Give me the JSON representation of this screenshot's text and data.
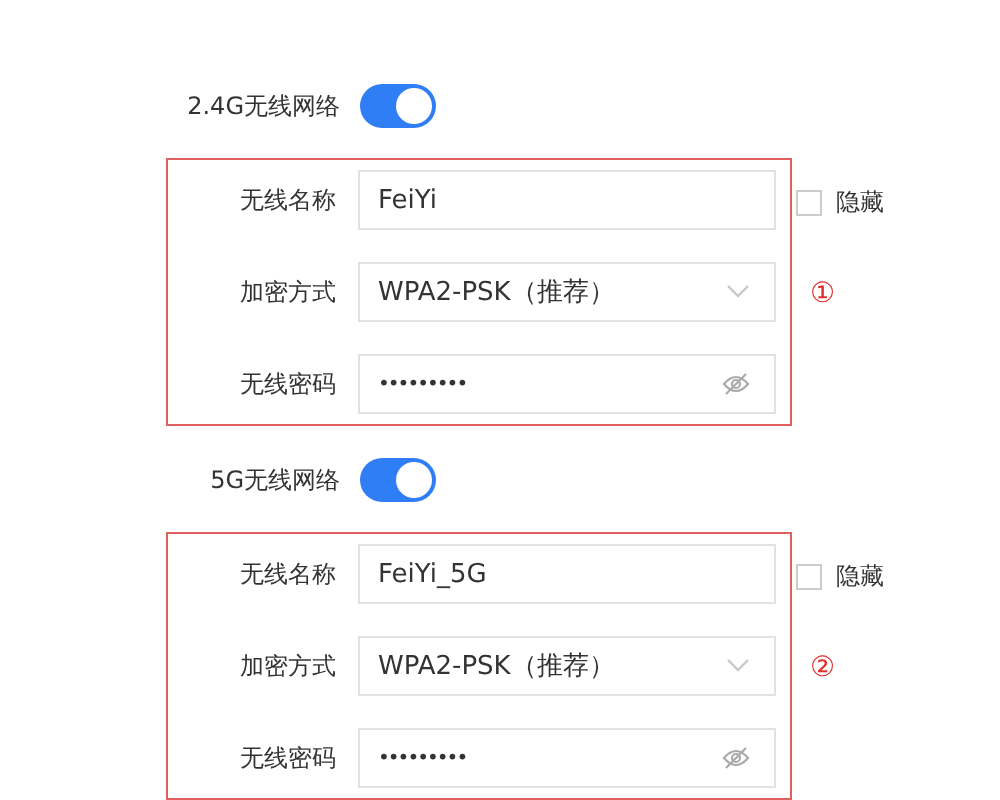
{
  "sections": [
    {
      "label": "2.4G无线网络",
      "enabled": true,
      "marker": "①",
      "fields": [
        {
          "kind": "text",
          "label": "无线名称",
          "value": "FeiYi",
          "hide": {
            "label": "隐藏",
            "checked": false
          }
        },
        {
          "kind": "select",
          "label": "加密方式",
          "value": "WPA2-PSK（推荐）"
        },
        {
          "kind": "password",
          "label": "无线密码",
          "value": "•••••••••"
        }
      ]
    },
    {
      "label": "5G无线网络",
      "enabled": true,
      "marker": "②",
      "fields": [
        {
          "kind": "text",
          "label": "无线名称",
          "value": "FeiYi_5G",
          "hide": {
            "label": "隐藏",
            "checked": false
          }
        },
        {
          "kind": "select",
          "label": "加密方式",
          "value": "WPA2-PSK（推荐）"
        },
        {
          "kind": "password",
          "label": "无线密码",
          "value": "•••••••••"
        }
      ]
    }
  ]
}
